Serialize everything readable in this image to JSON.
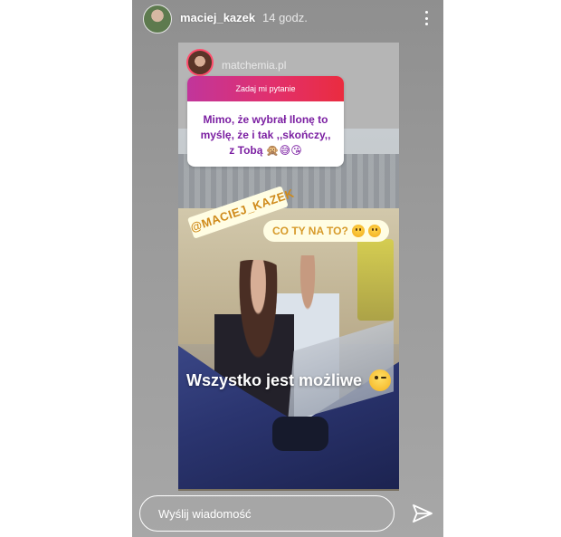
{
  "header": {
    "username": "maciej_kazek",
    "timestamp": "14 godz.",
    "avatar_icon": "user-avatar",
    "more_icon": "more-vertical-icon"
  },
  "repost": {
    "source_name": "matchemia.pl",
    "question_card": {
      "header": "Zadaj mi pytanie",
      "text": "Mimo, że wybrał Ilonę to myślę, że i tak ,,skończy,, z Tobą 🙊😅😘",
      "accent_colors": [
        "#c1359b",
        "#e2306c",
        "#ea2c3f"
      ]
    },
    "mention_tag": "@MACIEJ_KAZEK",
    "caption": "CO TY NA TO?",
    "caption_emojis": [
      "thinking-face-icon",
      "grinning-sweat-icon"
    ],
    "overlay_text": "Wszystko jest możliwe",
    "overlay_emoji": "winking-face-icon"
  },
  "footer": {
    "message_placeholder": "Wyślij wiadomość",
    "send_icon": "paper-plane-icon"
  }
}
